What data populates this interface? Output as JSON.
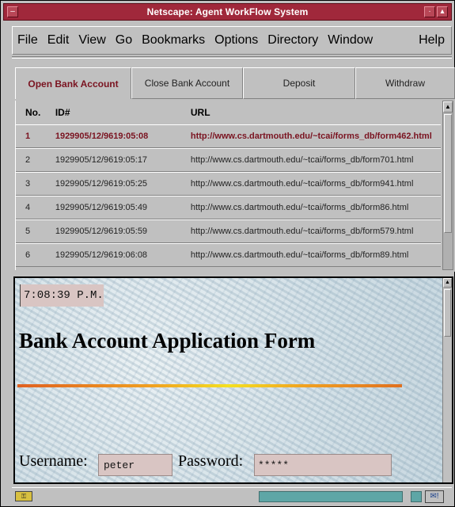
{
  "window": {
    "title": "Netscape: Agent WorkFlow System"
  },
  "menu": {
    "items": [
      "File",
      "Edit",
      "View",
      "Go",
      "Bookmarks",
      "Options",
      "Directory",
      "Window"
    ],
    "help": "Help"
  },
  "tabs": [
    "Open Bank Account",
    "Close Bank Account",
    "Deposit",
    "Withdraw"
  ],
  "table": {
    "headers": {
      "no": "No.",
      "id": "ID#",
      "url": "URL"
    },
    "rows": [
      {
        "no": "1",
        "id": "1929905/12/9619:05:08",
        "url": "http://www.cs.dartmouth.edu/~tcai/forms_db/form462.html"
      },
      {
        "no": "2",
        "id": "1929905/12/9619:05:17",
        "url": "http://www.cs.dartmouth.edu/~tcai/forms_db/form701.html"
      },
      {
        "no": "3",
        "id": "1929905/12/9619:05:25",
        "url": "http://www.cs.dartmouth.edu/~tcai/forms_db/form941.html"
      },
      {
        "no": "4",
        "id": "1929905/12/9619:05:49",
        "url": "http://www.cs.dartmouth.edu/~tcai/forms_db/form86.html"
      },
      {
        "no": "5",
        "id": "1929905/12/9619:05:59",
        "url": "http://www.cs.dartmouth.edu/~tcai/forms_db/form579.html"
      },
      {
        "no": "6",
        "id": "1929905/12/9619:06:08",
        "url": "http://www.cs.dartmouth.edu/~tcai/forms_db/form89.html"
      }
    ]
  },
  "form": {
    "time": "7:08:39 P.M.",
    "title": "Bank Account Application Form",
    "username_label": "Username:",
    "username_value": "peter",
    "password_label": "Password:",
    "password_value": "*****"
  },
  "colors": {
    "titlebar": "#a0283b",
    "selected_text": "#7a1320",
    "field_bg": "#d9c5c3",
    "progress": "#5ea6a6"
  },
  "icons": [
    "window-menu-icon",
    "minimize-icon",
    "maximize-icon",
    "security-key-icon",
    "mail-icon"
  ]
}
